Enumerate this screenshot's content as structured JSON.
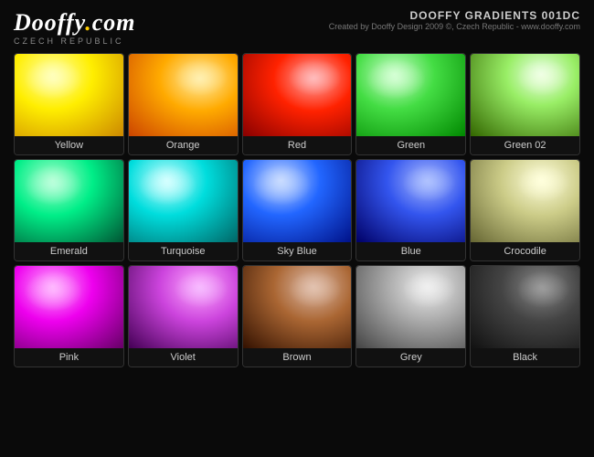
{
  "header": {
    "logo": "Dooffy.com",
    "logo_sub": "czech republic",
    "title": "DOOFFY GRADIENTS 001DC",
    "subtitle": "Created by Dooffy Design 2009 ©, Czech Republic - www.dooffy.com"
  },
  "swatches": [
    {
      "id": "yellow",
      "label": "Yellow",
      "class": "yellow"
    },
    {
      "id": "orange",
      "label": "Orange",
      "class": "orange"
    },
    {
      "id": "red",
      "label": "Red",
      "class": "red"
    },
    {
      "id": "green",
      "label": "Green",
      "class": "green"
    },
    {
      "id": "green02",
      "label": "Green 02",
      "class": "green02"
    },
    {
      "id": "emerald",
      "label": "Emerald",
      "class": "emerald"
    },
    {
      "id": "turquoise",
      "label": "Turquoise",
      "class": "turquoise"
    },
    {
      "id": "skyblue",
      "label": "Sky Blue",
      "class": "skyblue"
    },
    {
      "id": "blue",
      "label": "Blue",
      "class": "blue"
    },
    {
      "id": "crocodile",
      "label": "Crocodile",
      "class": "crocodile"
    },
    {
      "id": "pink",
      "label": "Pink",
      "class": "pink"
    },
    {
      "id": "violet",
      "label": "Violet",
      "class": "violet"
    },
    {
      "id": "brown",
      "label": "Brown",
      "class": "brown"
    },
    {
      "id": "grey",
      "label": "Grey",
      "class": "grey"
    },
    {
      "id": "black",
      "label": "Black",
      "class": "black"
    }
  ]
}
